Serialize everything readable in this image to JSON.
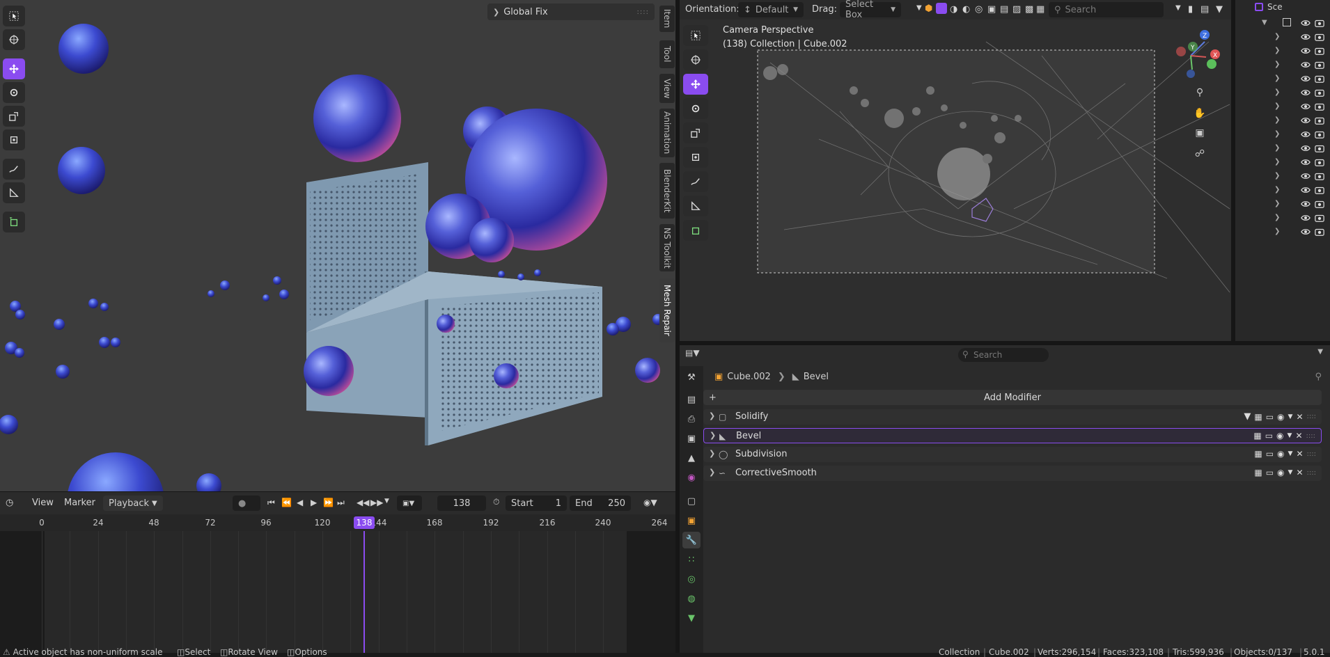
{
  "viewport_left": {
    "global_fix_label": "Global Fix",
    "side_tabs": [
      "Item",
      "Tool",
      "View",
      "Animation",
      "BlenderKit",
      "NS Toolkit",
      "Mesh Repair"
    ],
    "active_side_tab": "Mesh Repair"
  },
  "timeline": {
    "menu": {
      "view": "View",
      "marker": "Marker",
      "playback": "Playback"
    },
    "current_frame": "138",
    "start_label": "Start",
    "start_value": "1",
    "end_label": "End",
    "end_value": "250",
    "ticks": [
      "0",
      "24",
      "48",
      "72",
      "96",
      "120",
      "144",
      "168",
      "192",
      "216",
      "240",
      "264"
    ],
    "playhead_label": "138"
  },
  "camera_view": {
    "orientation_label": "Orientation:",
    "orientation_value": "Default",
    "drag_label": "Drag:",
    "drag_value": "Select Box",
    "search_placeholder": "Search",
    "camera_title": "Camera Perspective",
    "camera_subtitle": "(138) Collection | Cube.002",
    "gizmo_axes": [
      "X",
      "Y",
      "Z"
    ]
  },
  "outliner": {
    "header_label": "Sce",
    "row_count": 16
  },
  "properties": {
    "search_placeholder": "Search",
    "breadcrumb_object": "Cube.002",
    "breadcrumb_modifier": "Bevel",
    "add_modifier_label": "Add Modifier",
    "modifiers": [
      {
        "name": "Solidify",
        "icon": "solidify-icon",
        "active": false
      },
      {
        "name": "Bevel",
        "icon": "bevel-icon",
        "active": true
      },
      {
        "name": "Subdivision",
        "icon": "subdivision-icon",
        "active": false
      },
      {
        "name": "CorrectiveSmooth",
        "icon": "smooth-icon",
        "active": false
      }
    ]
  },
  "status_bar": {
    "warning": "Active object has non-uniform scale",
    "select": "Select",
    "rotate": "Rotate View",
    "options": "Options",
    "collection": "Collection",
    "object": "Cube.002",
    "verts": "Verts:296,154",
    "faces": "Faces:323,108",
    "tris": "Tris:599,936",
    "objects": "Objects:0/137",
    "version": "5.0.1"
  },
  "colors": {
    "accent": "#8a4cf0",
    "background": "#1d1d1d",
    "viewport_bg": "#3c3c3c"
  }
}
